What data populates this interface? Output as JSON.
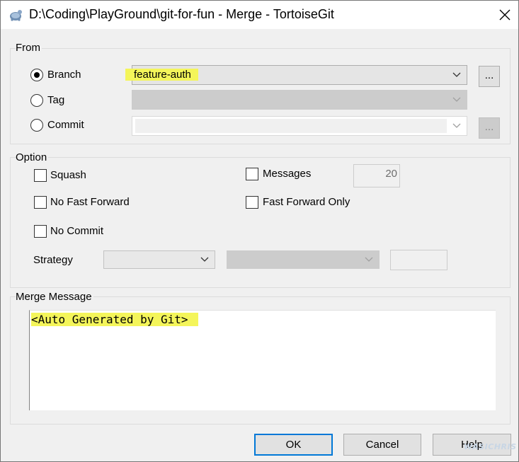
{
  "window": {
    "title": "D:\\Coding\\PlayGround\\git-for-fun - Merge - TortoiseGit"
  },
  "from": {
    "group_label": "From",
    "branch_label": "Branch",
    "tag_label": "Tag",
    "commit_label": "Commit",
    "selected": "Branch",
    "branch_value": "feature-auth",
    "browse_label": "..."
  },
  "option": {
    "group_label": "Option",
    "squash_label": "Squash",
    "no_fast_forward_label": "No Fast Forward",
    "no_commit_label": "No Commit",
    "messages_label": "Messages",
    "messages_value": "20",
    "fast_forward_only_label": "Fast Forward Only",
    "strategy_label": "Strategy"
  },
  "merge_message": {
    "group_label": "Merge Message",
    "text": "<Auto Generated by Git>"
  },
  "buttons": {
    "ok": "OK",
    "cancel": "Cancel",
    "help": "Help"
  },
  "watermark": "WASICHRIS",
  "colors": {
    "highlight": "#f4f55a",
    "default_button_border": "#0078d7"
  }
}
